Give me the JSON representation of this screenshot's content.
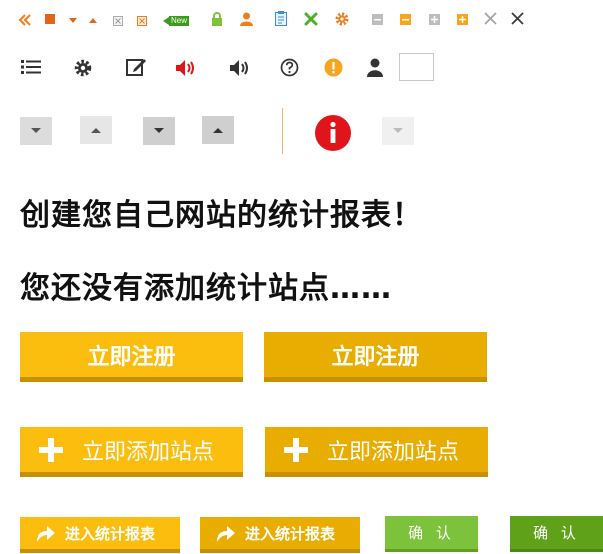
{
  "icons_row1": [
    "double-left-arrow-icon",
    "orange-square-icon",
    "dropdown-arrow-icon",
    "up-triangle-icon",
    "close-box-icon",
    "close-box-alt-icon",
    "new-badge-icon",
    "lock-icon",
    "user-icon",
    "clipboard-icon",
    "tools-icon",
    "gear-icon",
    "minimize-icon",
    "minimize-active-icon",
    "maximize-icon",
    "maximize-active-icon",
    "close-light-icon",
    "close-dark-icon"
  ],
  "new_badge": "New",
  "heading1": "创建您自己网站的统计报表！",
  "heading2": "您还没有添加统计站点……",
  "buttons": {
    "register_1": "立即注册",
    "register_2": "立即注册",
    "add_site_1": "立即添加站点",
    "add_site_2": "立即添加站点",
    "enter_report_1": "进入统计报表",
    "enter_report_2": "进入统计报表",
    "confirm_1": "确 认",
    "confirm_2": "确 认"
  },
  "colors": {
    "orange": "#ef7d1b",
    "yellow": "#fcbe0e",
    "yellow_dark": "#e8ad00",
    "yellow_border": "#c98f00",
    "green": "#7dc23b",
    "green_dark": "#5fa21a",
    "red": "#e0151b",
    "gray_tile": "#dcdcdc"
  }
}
